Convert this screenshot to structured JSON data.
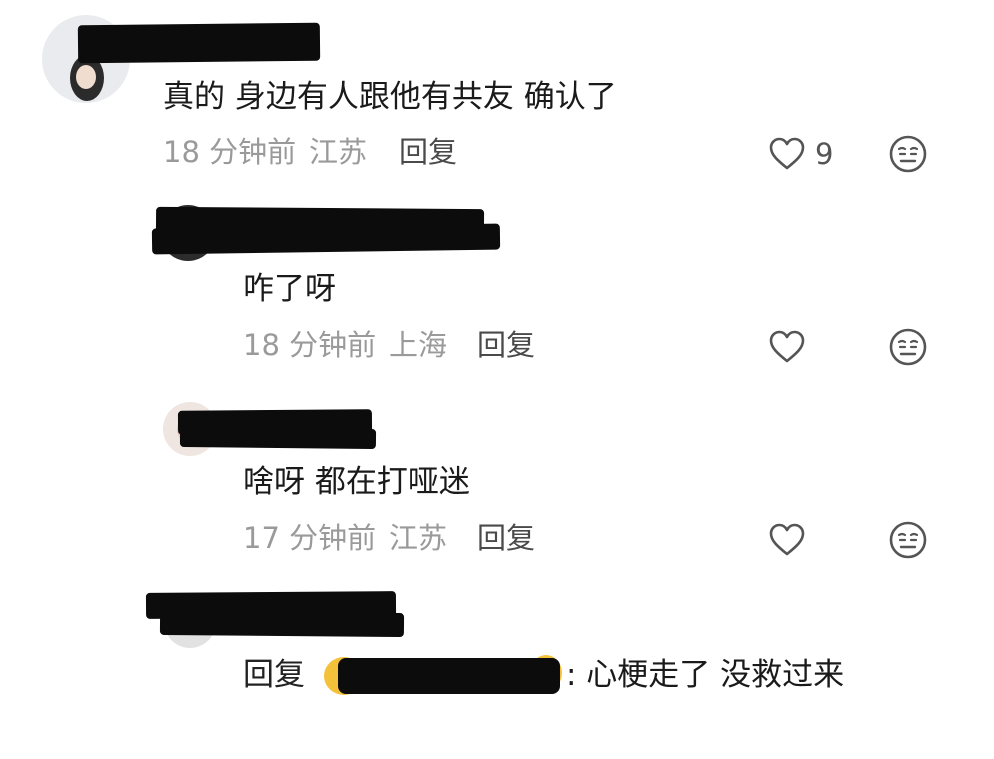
{
  "comments": [
    {
      "text": "真的 身边有人跟他有共友 确认了",
      "time": "18 分钟前",
      "location": "江苏",
      "reply_label": "回复",
      "like_count": "9"
    },
    {
      "text": "咋了呀",
      "time": "18 分钟前",
      "location": "上海",
      "reply_label": "回复",
      "like_count": ""
    },
    {
      "text": "啥呀 都在打哑迷",
      "time": "17 分钟前",
      "location": "江苏",
      "reply_label": "回复",
      "like_count": ""
    },
    {
      "reply_prefix": "回复",
      "text": ": 心梗走了 没救过来"
    }
  ],
  "icons": {
    "like": "heart-outline-icon",
    "dislike": "neutral-face-icon",
    "emoji": "emoji-face-icon"
  },
  "colors": {
    "text": "#1a1a1a",
    "meta": "#9a9a9a",
    "redaction": "#0c0c0c",
    "icon": "#555555"
  }
}
